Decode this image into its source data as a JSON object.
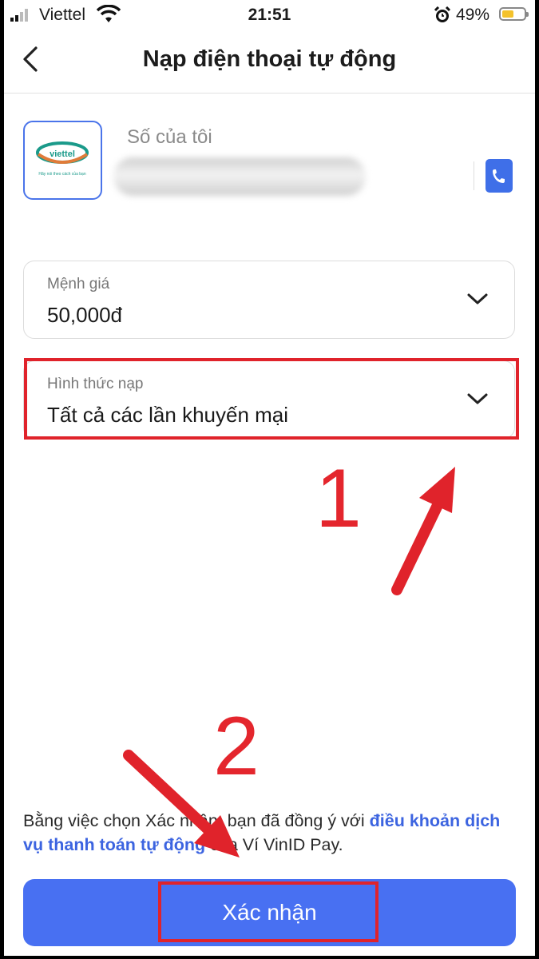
{
  "status_bar": {
    "carrier": "Viettel",
    "time": "21:51",
    "battery_percent": "49%",
    "icons": [
      "signal-icon",
      "wifi-icon",
      "alarm-icon",
      "battery-icon"
    ]
  },
  "header": {
    "title": "Nạp điện thoại tự động",
    "back_icon": "chevron-left-icon"
  },
  "phone": {
    "label": "Số của tôi",
    "number_hidden": true,
    "carrier_logo": "viettel-logo",
    "logo_text": "viettel",
    "logo_slogan": "Hãy nói theo cách của bạn",
    "contact_icon": "phone-contact-icon"
  },
  "denomination": {
    "label": "Mệnh giá",
    "value": "50,000đ"
  },
  "topup_type": {
    "label": "Hình thức nạp",
    "value": "Tất cả các lần khuyến mại"
  },
  "terms": {
    "prefix": "Bằng việc chọn Xác nhận, bạn đã đồng ý với ",
    "link": "điều khoản dịch vụ thanh toán tự động",
    "suffix": " của Ví VinID Pay."
  },
  "confirm_label": "Xác nhận",
  "annotations": {
    "step1": "1",
    "step2": "2",
    "color": "#e0232b"
  },
  "colors": {
    "accent": "#4870f2",
    "link": "#3c64e0"
  }
}
